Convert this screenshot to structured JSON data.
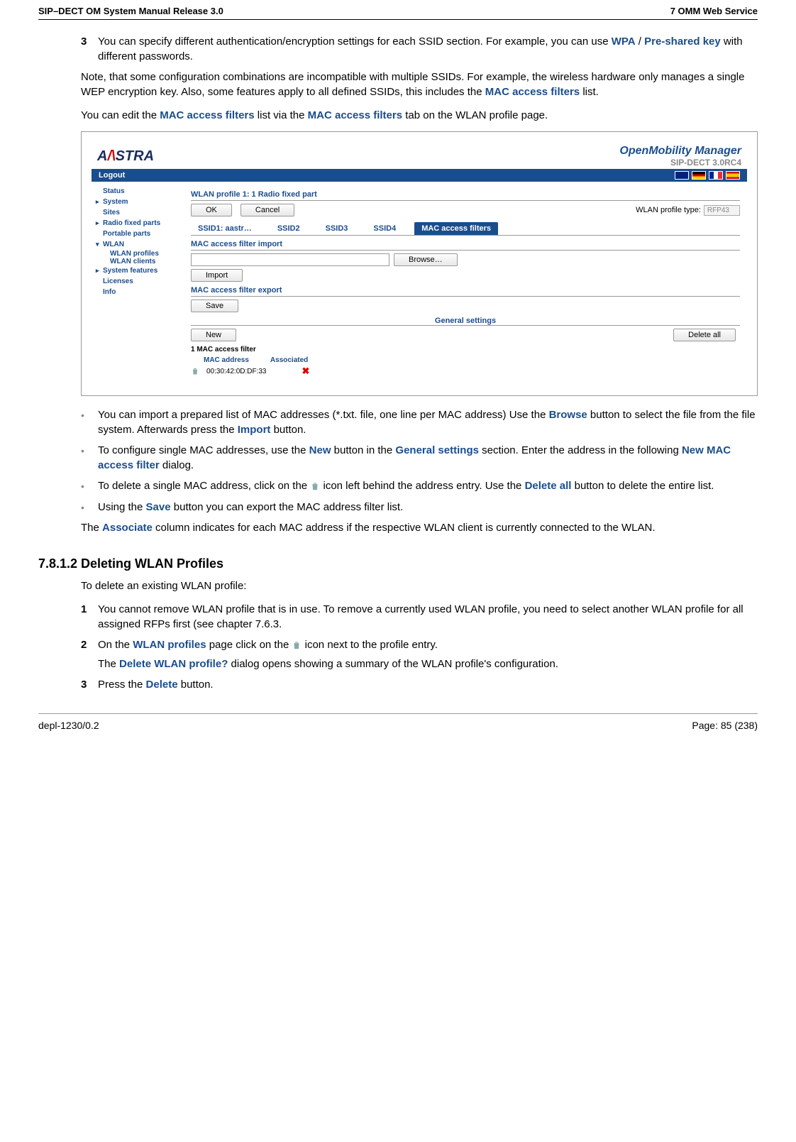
{
  "header": {
    "left": "SIP–DECT OM System Manual Release 3.0",
    "right": "7 OMM Web Service"
  },
  "footer": {
    "left": "depl-1230/0.2",
    "right": "Page: 85 (238)"
  },
  "p3": {
    "num": "3",
    "text_a": "You can specify different authentication/encryption settings for each SSID section. For example, you can use ",
    "wpa": "WPA",
    "sep": " / ",
    "psk": "Pre-shared key",
    "text_b": " with different passwords."
  },
  "p4a": "Note, that some configuration combinations are incompatible with multiple SSIDs. For example, the wireless hardware only manages a single WEP encryption key. Also, some features apply to all defined SSIDs, this includes the ",
  "p4_maf": "MAC access filters",
  "p4b": " list.",
  "p5a": "You can edit the ",
  "p5b": " list via the ",
  "p5c": " tab on the WLAN profile page.",
  "shot": {
    "logo_a": "A",
    "logo_red": "/\\",
    "logo_b": "STRA",
    "title1": "OpenMobility Manager",
    "title2": "SIP-DECT 3.0RC4",
    "logout": "Logout",
    "sidebar": {
      "status": "Status",
      "system": "System",
      "sites": "Sites",
      "rfp": "Radio fixed parts",
      "pp": "Portable parts",
      "wlan": "WLAN",
      "wprof": "WLAN profiles",
      "wclients": "WLAN clients",
      "sysfeat": "System features",
      "lic": "Licenses",
      "info": "Info"
    },
    "main": {
      "heading": "WLAN profile 1: 1 Radio fixed part",
      "ok": "OK",
      "cancel": "Cancel",
      "type_label": "WLAN profile type:",
      "type_value": "RFP43",
      "tabs": {
        "s1": "SSID1: aastr…",
        "s2": "SSID2",
        "s3": "SSID3",
        "s4": "SSID4",
        "maf": "MAC access filters"
      },
      "import_h": "MAC access filter import",
      "browse": "Browse…",
      "import": "Import",
      "export_h": "MAC access filter export",
      "save": "Save",
      "general": "General settings",
      "new": "New",
      "delall": "Delete all",
      "count": "1 MAC access filter",
      "col_mac": "MAC address",
      "col_assoc": "Associated",
      "mac": "00:30:42:0D:DF:33"
    }
  },
  "bul1": {
    "a": "You can import a prepared list of MAC addresses (*.txt. file, one line per MAC address) Use the ",
    "browse": "Browse",
    "b": " button to select the file from the file system. Afterwards press the ",
    "import": "Import",
    "c": " button."
  },
  "bul2": {
    "a": "To configure single MAC addresses, use the ",
    "new": "New",
    "b": " button in the ",
    "gs": "General settings",
    "c": " section. Enter the address in the following ",
    "nmaf": "New MAC access filter",
    "d": " dialog."
  },
  "bul3": {
    "a": "To delete a single MAC address, click on the ",
    "b": " icon left behind the address entry. Use the ",
    "da": "Delete all",
    "c": " button to delete the entire list."
  },
  "bul4": {
    "a": "Using the ",
    "save": "Save",
    "b": " button you can export the MAC address filter list."
  },
  "p6a": "The ",
  "p6_assoc": "Associate",
  "p6b": " column indicates for each MAC address if the respective WLAN client is currently connected to the WLAN.",
  "h3": {
    "num": "7.8.1.2",
    "title": "Deleting WLAN Profiles"
  },
  "p7": "To delete an existing WLAN profile:",
  "d1": {
    "num": "1",
    "txt": "You cannot remove WLAN profile that is in use. To remove a currently used WLAN profile, you need to select another WLAN profile for all assigned RFPs first (see chapter 7.6.3."
  },
  "d2": {
    "num": "2",
    "a": "On the ",
    "wp": "WLAN profiles",
    "b": " page click on the ",
    "c": " icon next to the profile entry.",
    "d": "The ",
    "dwp": "Delete WLAN profile?",
    "e": " dialog opens showing a summary of the WLAN profile's configuration."
  },
  "d3": {
    "num": "3",
    "a": "Press the ",
    "del": "Delete",
    "b": " button."
  }
}
